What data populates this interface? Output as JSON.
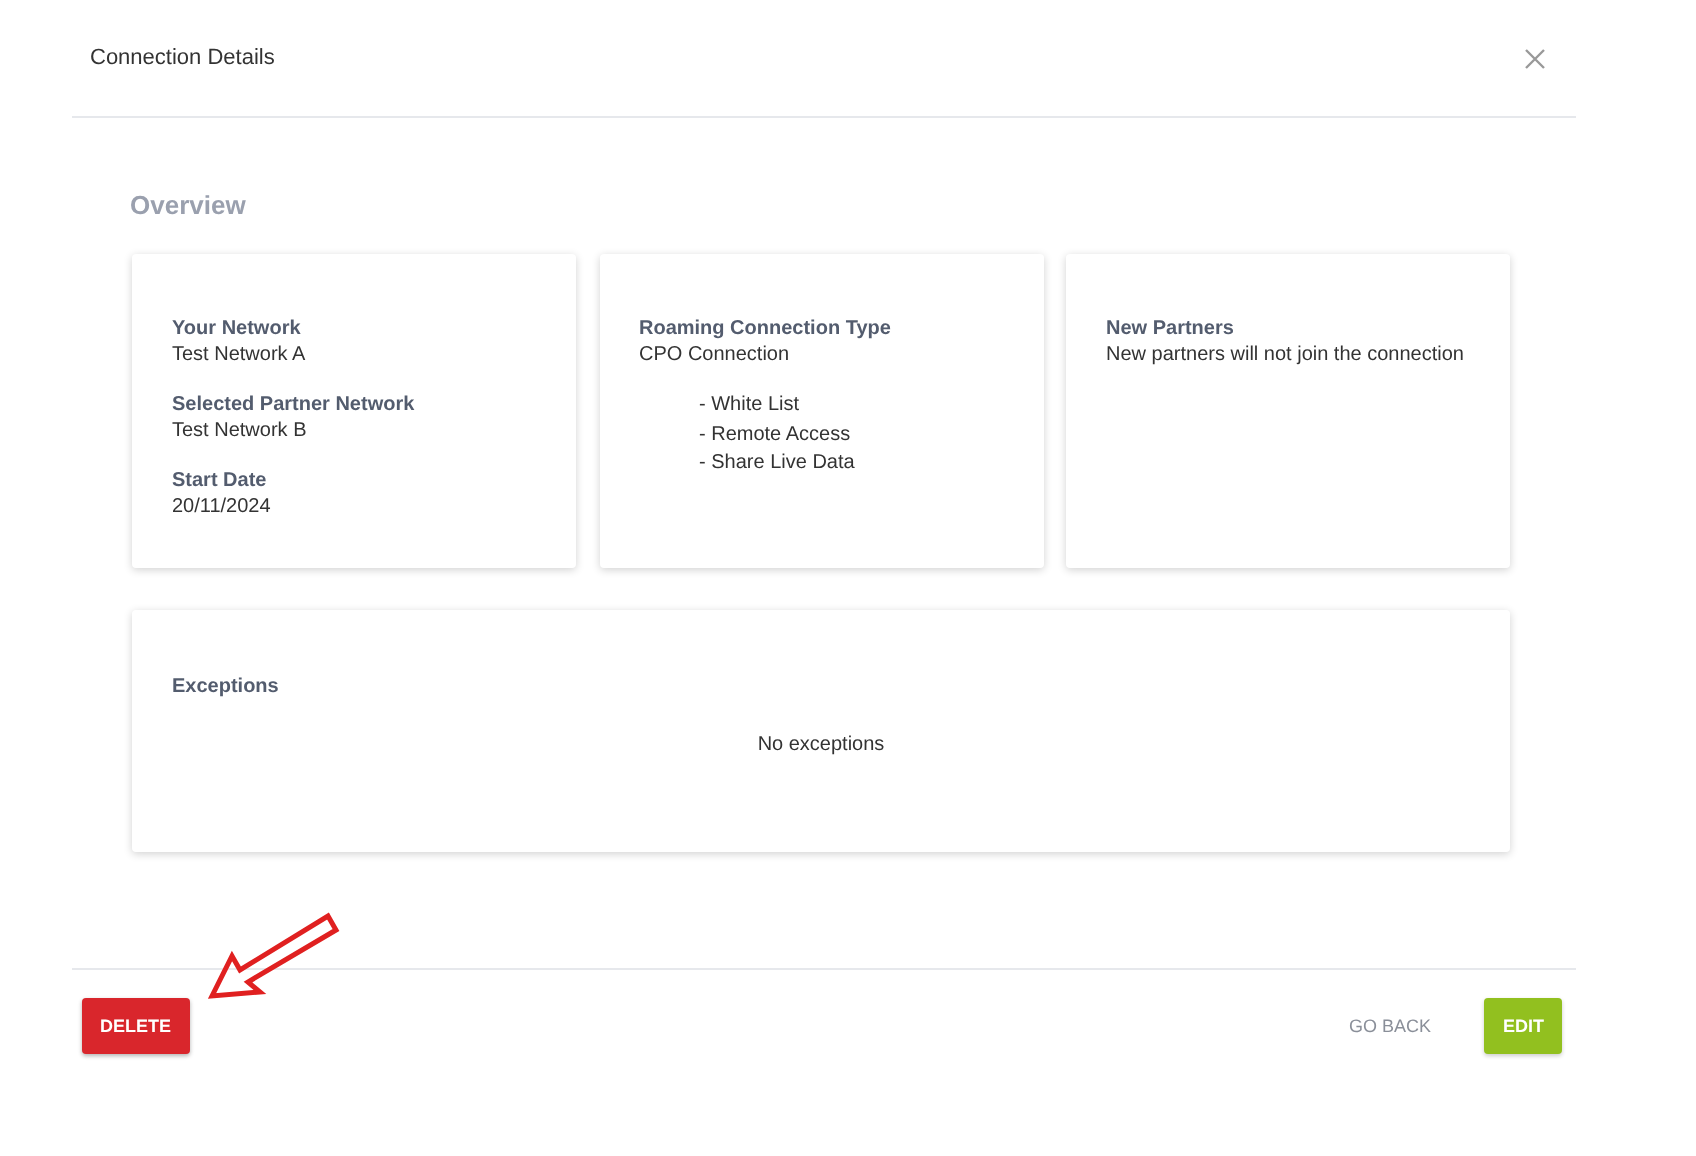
{
  "dialog": {
    "title": "Connection Details"
  },
  "overview": {
    "heading": "Overview",
    "cards": [
      {
        "fields": [
          {
            "label": "Your Network",
            "value": "Test Network A"
          },
          {
            "label": "Selected Partner Network",
            "value": "Test Network B"
          },
          {
            "label": "Start Date",
            "value": "20/11/2024"
          }
        ]
      },
      {
        "fields": [
          {
            "label": "Roaming Connection Type",
            "value": "CPO Connection",
            "items": [
              "- White List",
              "- Remote Access",
              "- Share Live Data"
            ]
          }
        ]
      },
      {
        "fields": [
          {
            "label": "New Partners",
            "value": "New partners will not join the connection"
          }
        ]
      }
    ],
    "exceptions": {
      "label": "Exceptions",
      "message": "No exceptions"
    }
  },
  "buttons": [
    {
      "kind": "danger",
      "label": "DELETE"
    },
    {
      "kind": "text",
      "label": "GO BACK"
    },
    {
      "kind": "primary",
      "label": "EDIT"
    }
  ]
}
